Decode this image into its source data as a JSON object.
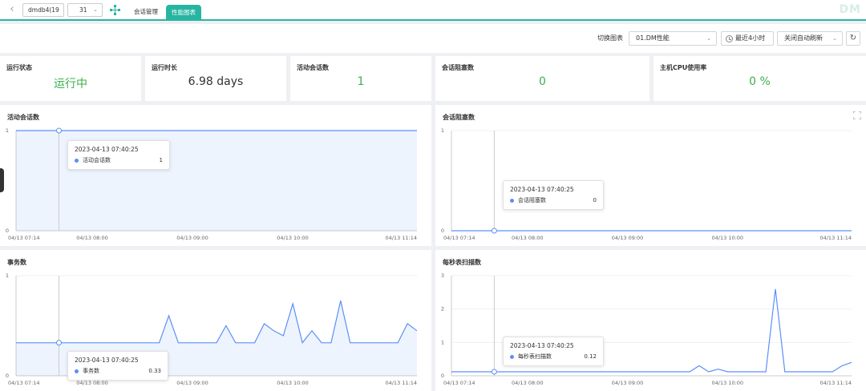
{
  "topbar": {
    "db_value": "dmdb4(19",
    "num_value": "31",
    "tabs": [
      {
        "label": "会话管理"
      },
      {
        "label": "性能图表"
      }
    ],
    "brand": "DM"
  },
  "toolbar": {
    "switch_label": "切换图表",
    "chart_select": "01.DM性能",
    "range_select": "最近4小时",
    "refresh_select": "关闭自动刷新"
  },
  "stats": [
    {
      "title": "运行状态",
      "value": "运行中"
    },
    {
      "title": "运行时长",
      "value": "6.98 days"
    },
    {
      "title": "活动会话数",
      "value": "1"
    },
    {
      "title": "会话阻塞数",
      "value": "0"
    },
    {
      "title": "主机CPU使用率",
      "value": "0 %"
    }
  ],
  "colors": {
    "accent": "#27b5a2",
    "series": "#5b8ff9",
    "ok": "#3cb04a"
  },
  "x_tick_labels": [
    "04/13 07:14",
    "04/13 08:00",
    "04/13 09:00",
    "04/13 10:00",
    "04/13 11:14"
  ],
  "charts": [
    {
      "title": "活动会话数",
      "tooltip": {
        "time": "2023-04-13 07:40:25",
        "name": "活动会话数",
        "value": "1"
      },
      "chart_data": {
        "type": "area",
        "y_ticks": [
          "1",
          "0"
        ],
        "ylim": [
          0,
          1
        ],
        "x_ticks": [
          "04/13 07:14",
          "04/13 08:00",
          "04/13 09:00",
          "04/13 10:00",
          "04/13 11:14"
        ],
        "series": [
          {
            "name": "活动会话数",
            "values": [
              1,
              1,
              1,
              1,
              1
            ]
          }
        ]
      }
    },
    {
      "title": "会话阻塞数",
      "tooltip": {
        "time": "2023-04-13 07:40:25",
        "name": "会话阻塞数",
        "value": "0"
      },
      "chart_data": {
        "type": "line",
        "y_ticks": [
          "1",
          "0"
        ],
        "ylim": [
          0,
          1
        ],
        "x_ticks": [
          "04/13 07:14",
          "04/13 08:00",
          "04/13 09:00",
          "04/13 10:00",
          "04/13 11:14"
        ],
        "series": [
          {
            "name": "会话阻塞数",
            "values": [
              0,
              0,
              0,
              0,
              0
            ]
          }
        ]
      }
    },
    {
      "title": "事务数",
      "tooltip": {
        "time": "2023-04-13 07:40:25",
        "name": "事务数",
        "value": "0.33"
      },
      "chart_data": {
        "type": "area",
        "y_ticks": [
          "1",
          "0"
        ],
        "ylim": [
          0,
          1
        ],
        "x_ticks": [
          "04/13 07:14",
          "04/13 08:00",
          "04/13 09:00",
          "04/13 10:00",
          "04/13 11:14"
        ],
        "series": [
          {
            "name": "事务数",
            "values": [
              0.33,
              0.33,
              0.33,
              0.33,
              0.33,
              0.33,
              0.33,
              0.33,
              0.33,
              0.33,
              0.33,
              0.33,
              0.33,
              0.33,
              0.33,
              0.33,
              0.6,
              0.33,
              0.33,
              0.33,
              0.33,
              0.33,
              0.5,
              0.33,
              0.33,
              0.33,
              0.52,
              0.45,
              0.4,
              0.72,
              0.33,
              0.45,
              0.33,
              0.33,
              0.75,
              0.33,
              0.33,
              0.33,
              0.33,
              0.33,
              0.33,
              0.52,
              0.45
            ]
          }
        ]
      }
    },
    {
      "title": "每秒表扫描数",
      "tooltip": {
        "time": "2023-04-13 07:40:25",
        "name": "每秒表扫描数",
        "value": "0.12"
      },
      "chart_data": {
        "type": "line",
        "y_ticks": [
          "3",
          "2",
          "1",
          "0"
        ],
        "ylim": [
          0,
          3
        ],
        "x_ticks": [
          "04/13 07:14",
          "04/13 08:00",
          "04/13 09:00",
          "04/13 10:00",
          "04/13 11:14"
        ],
        "series": [
          {
            "name": "每秒表扫描数",
            "values": [
              0.12,
              0.12,
              0.12,
              0.12,
              0.12,
              0.12,
              0.12,
              0.12,
              0.12,
              0.12,
              0.12,
              0.12,
              0.12,
              0.12,
              0.12,
              0.12,
              0.12,
              0.12,
              0.12,
              0.12,
              0.12,
              0.12,
              0.12,
              0.12,
              0.12,
              0.12,
              0.3,
              0.12,
              0.2,
              0.12,
              0.12,
              0.12,
              0.12,
              0.12,
              2.6,
              0.12,
              0.12,
              0.12,
              0.12,
              0.12,
              0.12,
              0.3,
              0.4
            ]
          }
        ]
      }
    }
  ]
}
